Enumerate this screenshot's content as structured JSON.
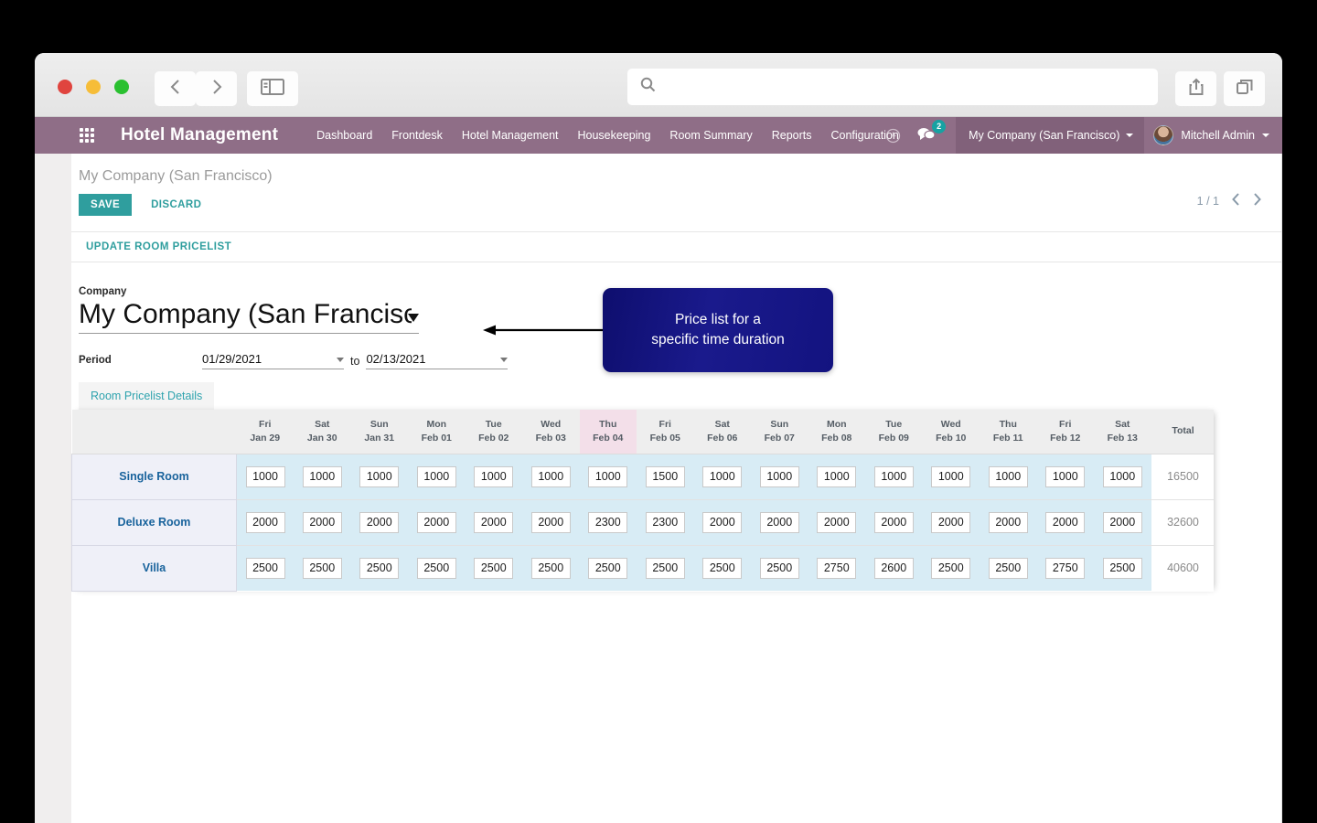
{
  "browser": {
    "url_value": "",
    "url_placeholder": "",
    "back_label": "Back",
    "forward_label": "Forward",
    "sidebar_label": "Show sidebar",
    "share_label": "Share",
    "tabs_label": "Show tab overview"
  },
  "topbar": {
    "apps_icon": "apps-grid-icon",
    "brand": "Hotel Management",
    "menus": [
      "Dashboard",
      "Frontdesk",
      "Hotel Management",
      "Housekeeping",
      "Room Summary",
      "Reports",
      "Configuration"
    ],
    "clock_icon": "clock-icon",
    "chat_icon": "chat-icon",
    "chat_badge": "2",
    "company": "My Company (San Francisco)",
    "user": "Mitchell Admin",
    "bar_color": "#8f6e87",
    "accent_color": "#17a2a2"
  },
  "control_panel": {
    "breadcrumb": "My Company (San Francisco)",
    "save_label": "SAVE",
    "discard_label": "DISCARD",
    "pager_text": "1 / 1",
    "prev_label": "Previous",
    "next_label": "Next",
    "status_action": "UPDATE ROOM PRICELIST"
  },
  "form": {
    "company_label": "Company",
    "company_value": "My Company (San Francisco)",
    "period_label": "Period",
    "period_from": "01/29/2021",
    "period_to_label": "to",
    "period_to": "02/13/2021"
  },
  "callout": {
    "line1": "Price list for a",
    "line2": "specific time duration",
    "color": "#131380"
  },
  "tab": {
    "label": "Room Pricelist Details"
  },
  "chart_data": {
    "type": "table",
    "title": "Room Pricelist Details",
    "row_header": "",
    "total_header": "Total",
    "columns": [
      {
        "dow": "Fri",
        "date": "Jan 29",
        "today": false
      },
      {
        "dow": "Sat",
        "date": "Jan 30",
        "today": false
      },
      {
        "dow": "Sun",
        "date": "Jan 31",
        "today": false
      },
      {
        "dow": "Mon",
        "date": "Feb 01",
        "today": false
      },
      {
        "dow": "Tue",
        "date": "Feb 02",
        "today": false
      },
      {
        "dow": "Wed",
        "date": "Feb 03",
        "today": false
      },
      {
        "dow": "Thu",
        "date": "Feb 04",
        "today": true
      },
      {
        "dow": "Fri",
        "date": "Feb 05",
        "today": false
      },
      {
        "dow": "Sat",
        "date": "Feb 06",
        "today": false
      },
      {
        "dow": "Sun",
        "date": "Feb 07",
        "today": false
      },
      {
        "dow": "Mon",
        "date": "Feb 08",
        "today": false
      },
      {
        "dow": "Tue",
        "date": "Feb 09",
        "today": false
      },
      {
        "dow": "Wed",
        "date": "Feb 10",
        "today": false
      },
      {
        "dow": "Thu",
        "date": "Feb 11",
        "today": false
      },
      {
        "dow": "Fri",
        "date": "Feb 12",
        "today": false
      },
      {
        "dow": "Sat",
        "date": "Feb 13",
        "today": false
      }
    ],
    "rows": [
      {
        "name": "Single Room",
        "values": [
          1000,
          1000,
          1000,
          1000,
          1000,
          1000,
          1000,
          1500,
          1000,
          1000,
          1000,
          1000,
          1000,
          1000,
          1000,
          1000
        ],
        "total": 16500
      },
      {
        "name": "Deluxe Room",
        "values": [
          2000,
          2000,
          2000,
          2000,
          2000,
          2000,
          2300,
          2300,
          2000,
          2000,
          2000,
          2000,
          2000,
          2000,
          2000,
          2000
        ],
        "total": 32600
      },
      {
        "name": "Villa",
        "values": [
          2500,
          2500,
          2500,
          2500,
          2500,
          2500,
          2500,
          2500,
          2500,
          2500,
          2750,
          2600,
          2500,
          2500,
          2750,
          2500
        ],
        "total": 40600
      }
    ]
  }
}
